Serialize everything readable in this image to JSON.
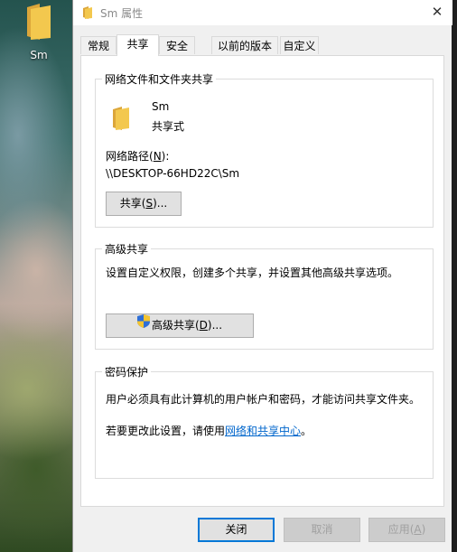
{
  "desktop": {
    "icon_label": "Sm"
  },
  "window": {
    "title": "Sm 属性",
    "close_glyph": "✕"
  },
  "tabs": [
    {
      "label": "常规"
    },
    {
      "label": "共享"
    },
    {
      "label": "安全"
    },
    {
      "label": "以前的版本"
    },
    {
      "label": "自定义"
    }
  ],
  "network_share": {
    "group_title": "网络文件和文件夹共享",
    "folder_name": "Sm",
    "folder_status": "共享式",
    "path_label_pre": "网络路径(",
    "path_label_key": "N",
    "path_label_post": "):",
    "path_value": "\\\\DESKTOP-66HD22C\\Sm",
    "share_button_pre": "共享(",
    "share_button_key": "S",
    "share_button_post": ")..."
  },
  "advanced_share": {
    "group_title": "高级共享",
    "description": "设置自定义权限，创建多个共享，并设置其他高级共享选项。",
    "button_pre": "高级共享(",
    "button_key": "D",
    "button_post": ")..."
  },
  "password_protection": {
    "group_title": "密码保护",
    "line1": "用户必须具有此计算机的用户帐户和密码，才能访问共享文件夹。",
    "line2_pre": "若要更改此设置，请使用",
    "line2_link": "网络和共享中心",
    "line2_post": "。"
  },
  "footer": {
    "close_label": "关闭",
    "cancel_label": "取消",
    "apply_pre": "应用(",
    "apply_key": "A",
    "apply_post": ")"
  },
  "colors": {
    "accent": "#0078d7",
    "link": "#0066cc",
    "folder": "#f3c84e"
  },
  "active_tab": "共享"
}
